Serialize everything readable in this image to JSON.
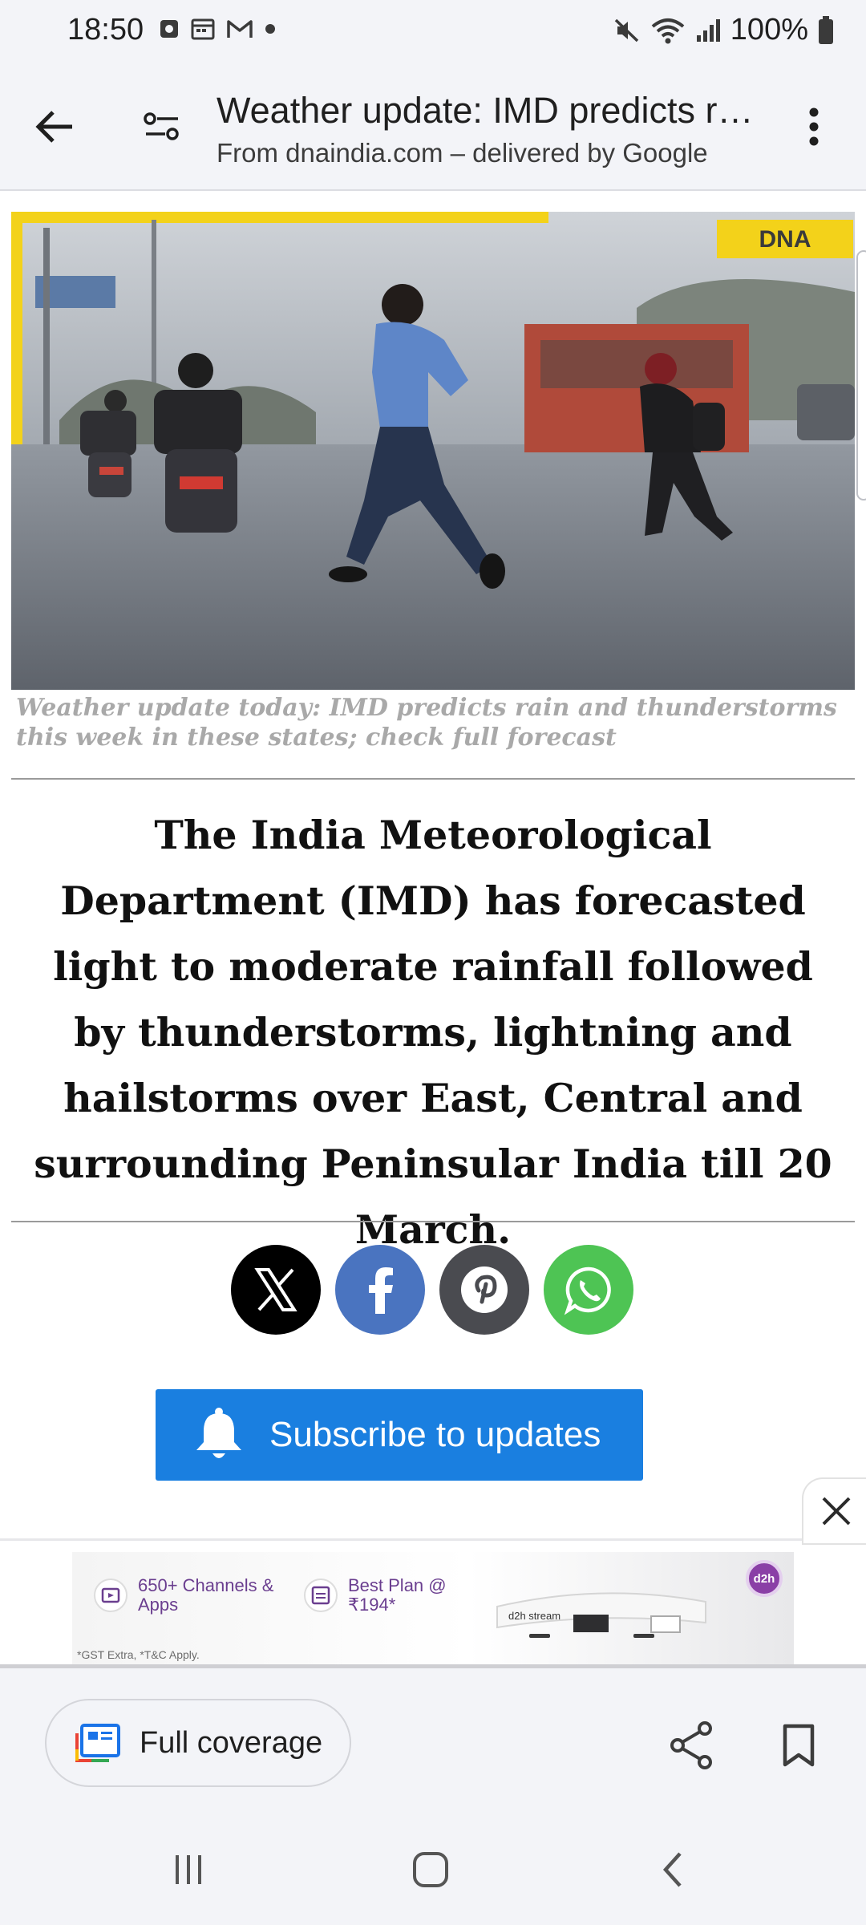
{
  "status_bar": {
    "time": "18:50",
    "battery": "100%",
    "left_icons": [
      "notification-app-icon",
      "calendar-icon",
      "gmail-icon",
      "dot-icon"
    ],
    "right_icons": [
      "mute-icon",
      "wifi-icon",
      "signal-icon",
      "battery-icon"
    ]
  },
  "app_bar": {
    "title": "Weather update: IMD predicts rai...",
    "subtitle": "From dnaindia.com – delivered by Google"
  },
  "article": {
    "hero_badge": "DNA",
    "caption": "Weather update today: IMD predicts rain and thunderstorms this week in these states; check full forecast",
    "lead": "The India Meteorological Department (IMD) has forecasted light to moderate rainfall followed by thunderstorms, lightning and hailstorms over East, Central and surrounding Peninsular India till 20 March.",
    "share_buttons": [
      {
        "name": "x",
        "color": "#000000"
      },
      {
        "name": "facebook",
        "color": "#4a74c0"
      },
      {
        "name": "pinterest",
        "color": "#4a4b50"
      },
      {
        "name": "whatsapp",
        "color": "#4ec454"
      }
    ],
    "subscribe_label": "Subscribe to updates"
  },
  "ad": {
    "item1": "650+ Channels & Apps",
    "item2": "Best Plan @ ₹194*",
    "brand": "d2h",
    "device_brand": "d2h stream",
    "fine_print": "*GST Extra, *T&C Apply."
  },
  "bottom_bar": {
    "full_coverage_label": "Full coverage"
  },
  "colors": {
    "accent": "#1a7fe0",
    "chrome": "#f3f4f8"
  }
}
